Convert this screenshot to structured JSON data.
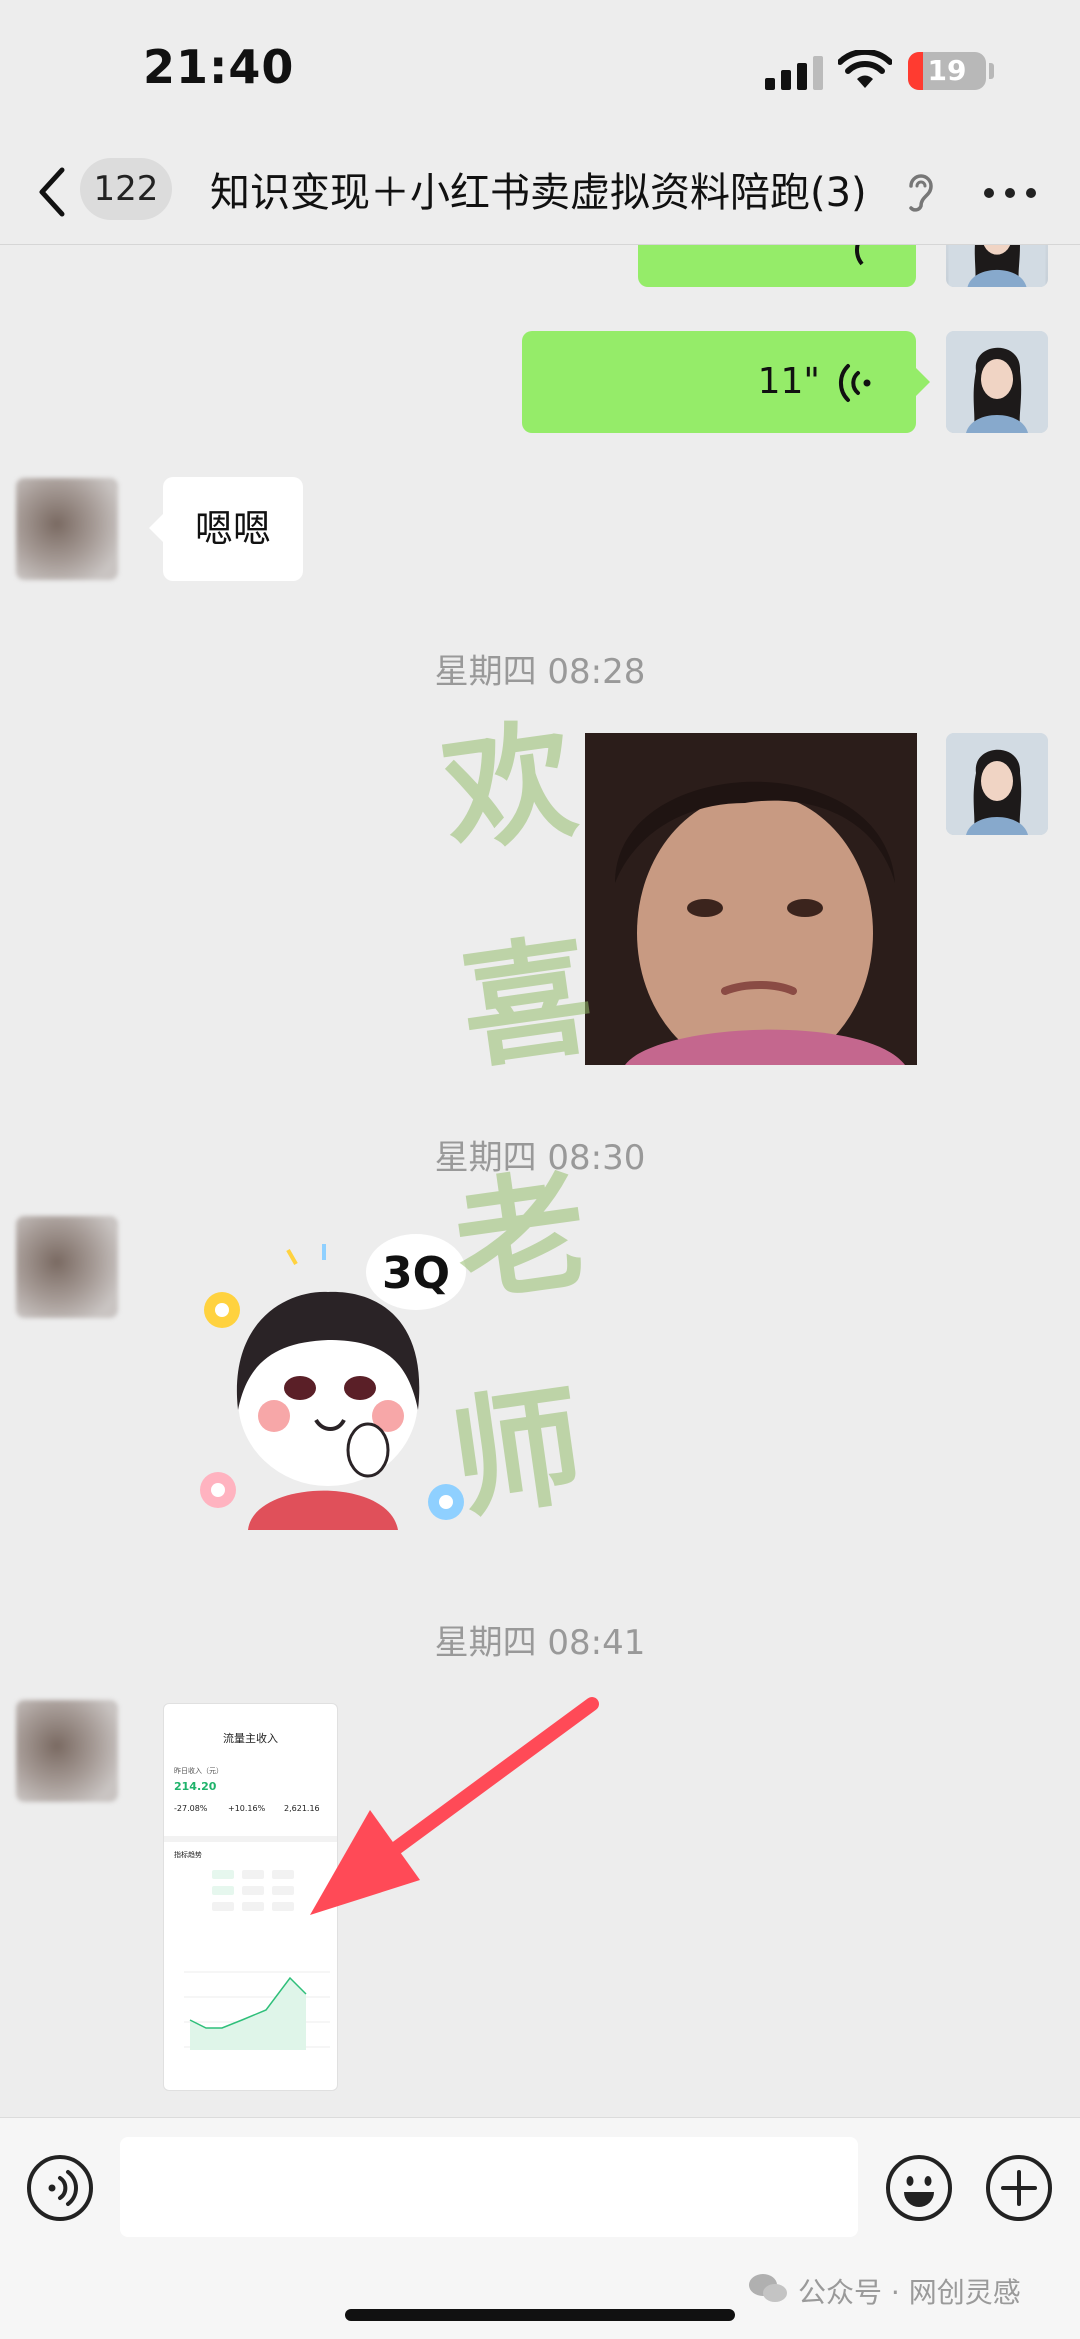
{
  "status_bar": {
    "time": "21:40",
    "battery": "19",
    "battery_level": 0.19
  },
  "nav": {
    "unread_count": "122",
    "title": "知识变现＋小红书卖虚拟资料陪跑(3)",
    "icons": [
      "chevron-left-icon",
      "ear-icon",
      "more-icon"
    ]
  },
  "messages": {
    "voice_1": {
      "duration": "11\""
    },
    "reply_text": "嗯嗯",
    "time_1": "星期四 08:28",
    "time_2": "星期四 08:30",
    "time_3": "星期四 08:41",
    "sticker_text": "3Q"
  },
  "watermark": [
    "欢",
    "喜",
    "老",
    "师"
  ],
  "thumb": {
    "title": "流量主收入",
    "label_yesterday": "昨日收入（元）",
    "value_yesterday": "214.20",
    "stat_1": "-27.08%",
    "stat_2": "+10.16%",
    "stat_3": "2,621.16",
    "section": "指标趋势"
  },
  "footer": {
    "brand": "公众号 · 网创灵感"
  },
  "colors": {
    "accent_green": "#95ec69",
    "background": "#ededed",
    "arrow_red": "#ff4a57"
  }
}
